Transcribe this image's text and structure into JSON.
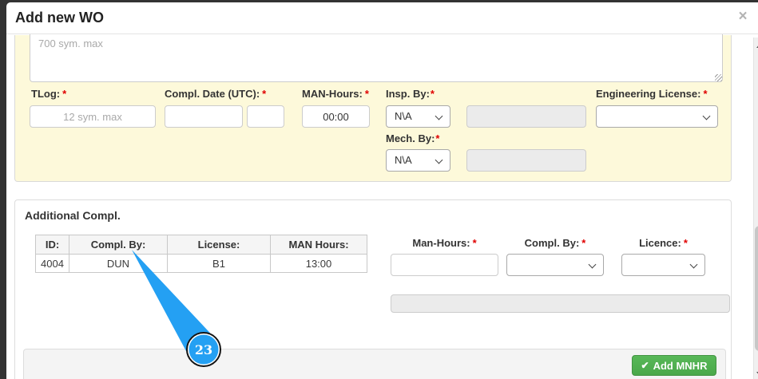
{
  "ui": {
    "required_mark": "*"
  },
  "modal": {
    "title": "Add new WO",
    "close_glyph": "×"
  },
  "main_form": {
    "notes_placeholder": "700 sym. max",
    "tlog": {
      "label": "TLog:",
      "placeholder": "12 sym. max"
    },
    "compl_date": {
      "label": "Compl. Date (UTC):"
    },
    "man_hours": {
      "label": "MAN-Hours:",
      "value": "00:00"
    },
    "insp_by": {
      "label": "Insp. By:",
      "selected": "N\\A"
    },
    "engineering_license": {
      "label": "Engineering License:"
    },
    "mech_by": {
      "label": "Mech. By:",
      "selected": "N\\A"
    }
  },
  "additional_compl": {
    "heading": "Additional Compl.",
    "table": {
      "headers": [
        "ID:",
        "Compl. By:",
        "License:",
        "MAN Hours:"
      ],
      "rows": [
        {
          "id": "4004",
          "compl_by": "DUN",
          "license": "B1",
          "man_hours": "13:00"
        }
      ]
    },
    "man_hours_label": "Man-Hours:",
    "compl_by_label": "Compl. By:",
    "licence_label": "Licence:",
    "add_button": {
      "label": "Add MNHR",
      "icon_glyph": "✔"
    }
  },
  "callout": {
    "number": "23"
  },
  "colors": {
    "accent_blue": "#24a0f3",
    "button_green": "#4cae4c",
    "panel_yellow": "#fdf9da"
  }
}
